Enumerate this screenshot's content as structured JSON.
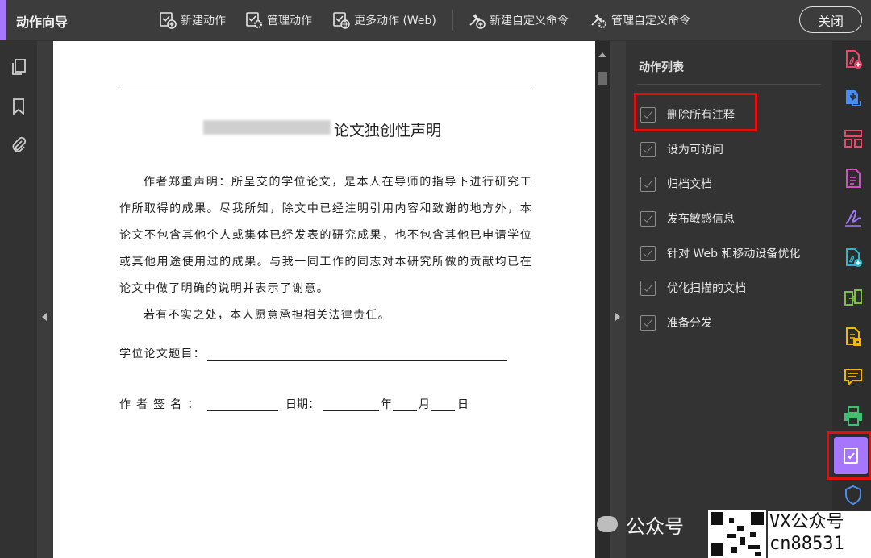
{
  "toolbar": {
    "title": "动作向导",
    "buttons": [
      {
        "label": "新建动作",
        "icon": "new-action-icon"
      },
      {
        "label": "管理动作",
        "icon": "manage-action-icon"
      },
      {
        "label": "更多动作 (Web)",
        "icon": "more-actions-web-icon"
      },
      {
        "label": "新建自定义命令",
        "icon": "new-custom-command-icon"
      },
      {
        "label": "管理自定义命令",
        "icon": "manage-custom-command-icon"
      }
    ],
    "close_label": "关闭"
  },
  "document": {
    "title_suffix": "论文独创性声明",
    "paragraph": "作者郑重声明：所呈交的学位论文，是本人在导师的指导下进行研究工作所取得的成果。尽我所知，除文中已经注明引用内容和致谢的地方外，本论文不包含其他个人或集体已经发表的研究成果，也不包含其他已申请学位或其他用途使用过的成果。与我一同工作的同志对本研究所做的贡献均已在论文中做了明确的说明并表示了谢意。",
    "line2": "若有不实之处，本人愿意承担相关法律责任。",
    "field_title_label": "学位论文题目：",
    "author_label": "作 者 签 名 ：",
    "date_label": "日期：",
    "year": "年",
    "month": "月",
    "day": "日"
  },
  "panel": {
    "title": "动作列表",
    "items": [
      {
        "label": "删除所有注释"
      },
      {
        "label": "设为可访问"
      },
      {
        "label": "归档文档"
      },
      {
        "label": "发布敏感信息"
      },
      {
        "label": "针对 Web 和移动设备优化"
      },
      {
        "label": "优化扫描的文档"
      },
      {
        "label": "准备分发"
      }
    ]
  },
  "colors": {
    "accent": "#a676ff",
    "highlight": "#e01010",
    "toolbar_bg": "#3c3c3c",
    "panel_bg": "#333333"
  },
  "overlay": {
    "wechat": "公众号",
    "vx_line1": "VX公众号",
    "vx_line2": "cn88531"
  }
}
